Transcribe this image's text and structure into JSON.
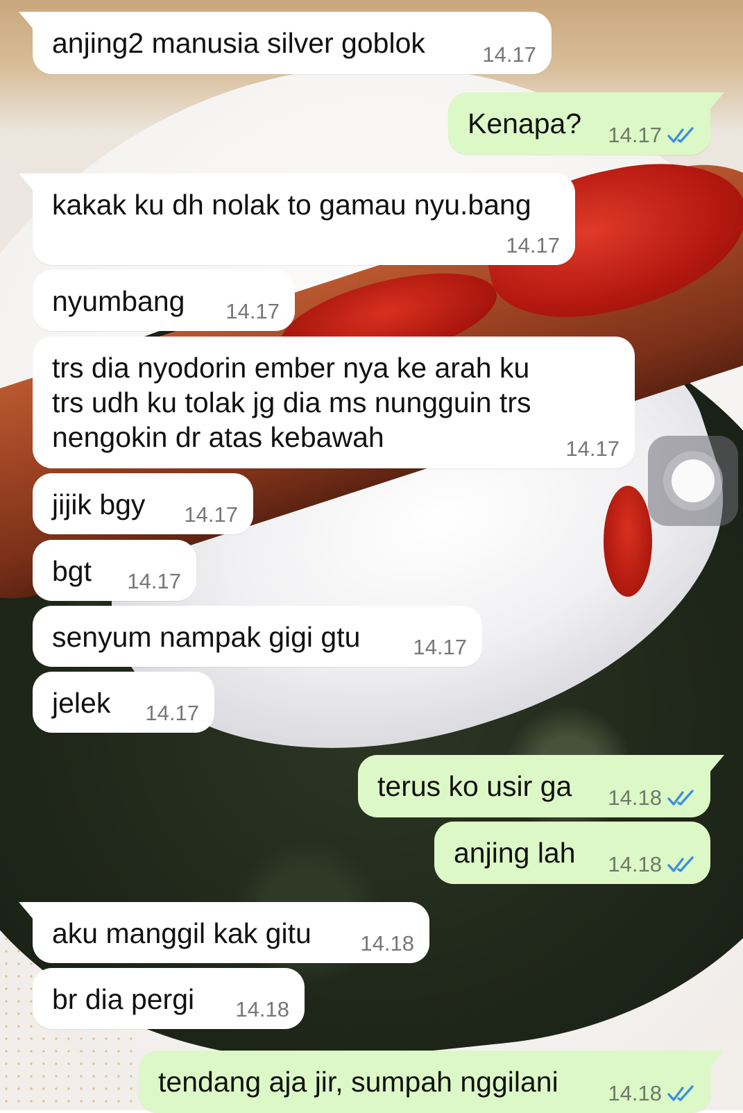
{
  "colors": {
    "incoming_bubble": "#ffffff",
    "outgoing_bubble": "#dcf8c6",
    "read_ticks": "#3b8fe0",
    "timestamp": "#777777"
  },
  "messages": [
    {
      "dir": "in",
      "text": "anjing2 manusia silver goblok",
      "time": "14.17"
    },
    {
      "dir": "out",
      "text": "Kenapa?",
      "time": "14.17",
      "status": "read"
    },
    {
      "dir": "in",
      "text": "kakak ku dh nolak to gamau nyu.bang",
      "time": "14.17"
    },
    {
      "dir": "in",
      "text": "nyumbang",
      "time": "14.17"
    },
    {
      "dir": "in",
      "lines": [
        "trs dia nyodorin ember nya ke arah ku",
        "trs udh ku tolak jg dia ms nungguin trs",
        "nengokin dr atas kebawah"
      ],
      "time": "14.17"
    },
    {
      "dir": "in",
      "text": "jijik bgy",
      "time": "14.17"
    },
    {
      "dir": "in",
      "text": "bgt",
      "time": "14.17"
    },
    {
      "dir": "in",
      "text": "senyum nampak gigi gtu",
      "time": "14.17"
    },
    {
      "dir": "in",
      "text": "jelek",
      "time": "14.17"
    },
    {
      "dir": "out",
      "text": "terus ko usir ga",
      "time": "14.18",
      "status": "read"
    },
    {
      "dir": "out",
      "text": "anjing lah",
      "time": "14.18",
      "status": "read"
    },
    {
      "dir": "in",
      "text": "aku manggil kak gitu",
      "time": "14.18"
    },
    {
      "dir": "in",
      "text": "br dia pergi",
      "time": "14.18"
    },
    {
      "dir": "out",
      "text": "tendang aja jir, sumpah nggilani",
      "time": "14.18",
      "status": "read"
    }
  ],
  "icons": {
    "read_status": "double-check-icon",
    "floating_button": "assistive-touch-icon"
  }
}
